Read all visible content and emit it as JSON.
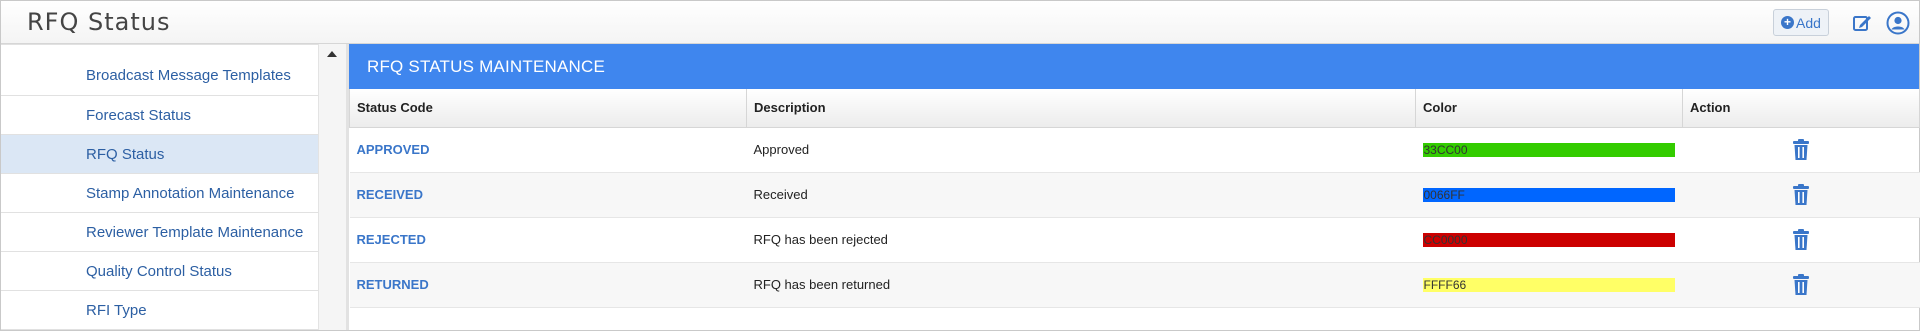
{
  "app": {
    "title": "RFQ Status"
  },
  "toolbar": {
    "add_label": "Add"
  },
  "sidebar": {
    "items": [
      {
        "label": "Broadcast Message Templates",
        "active": false
      },
      {
        "label": "Forecast Status",
        "active": false
      },
      {
        "label": "RFQ Status",
        "active": true
      },
      {
        "label": "Stamp Annotation Maintenance",
        "active": false
      },
      {
        "label": "Reviewer Template Maintenance",
        "active": false
      },
      {
        "label": "Quality Control Status",
        "active": false
      },
      {
        "label": "RFI Type",
        "active": false
      }
    ]
  },
  "panel": {
    "title": "RFQ STATUS MAINTENANCE",
    "columns": [
      "Status Code",
      "Description",
      "Color",
      "Action"
    ],
    "rows": [
      {
        "code": "APPROVED",
        "description": "Approved",
        "color": "33CC00",
        "swatch": "#33cc00"
      },
      {
        "code": "RECEIVED",
        "description": "Received",
        "color": "0066FF",
        "swatch": "#0066ff"
      },
      {
        "code": "REJECTED",
        "description": "RFQ has been rejected",
        "color": "CC0000",
        "swatch": "#cc0000"
      },
      {
        "code": "RETURNED",
        "description": "RFQ has been returned",
        "color": "FFFF66",
        "swatch": "#ffff66"
      }
    ]
  },
  "icons": {
    "add": "plus-circle-icon",
    "edit": "edit-icon",
    "user": "user-icon",
    "delete": "trash-icon"
  },
  "colors": {
    "accent": "#3f86ee",
    "link": "#3a76c9",
    "active_row": "#dbe7f5"
  }
}
